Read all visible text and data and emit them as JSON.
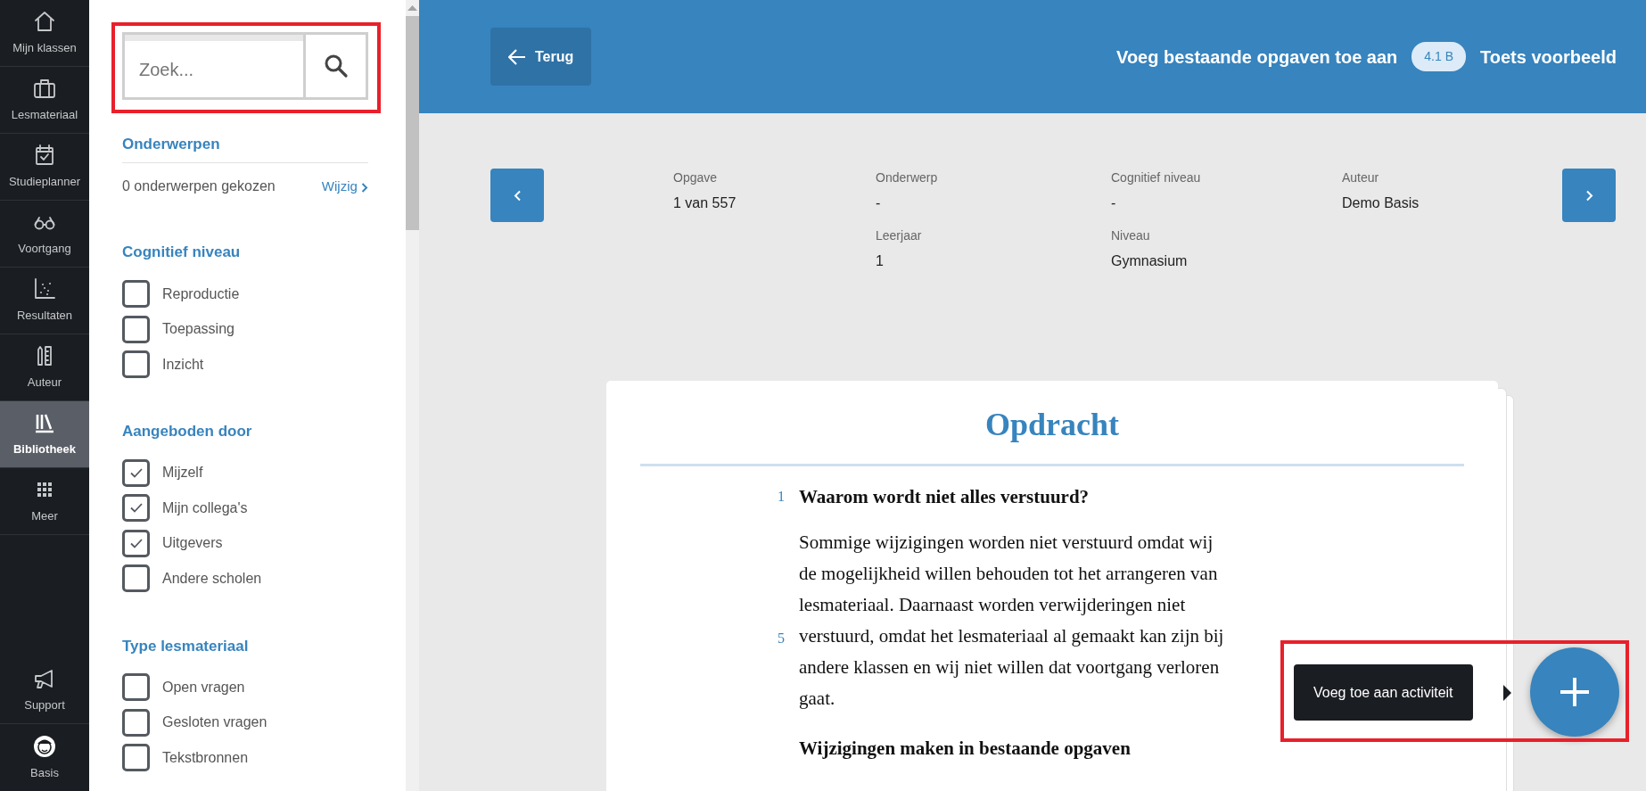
{
  "nav": {
    "items": [
      {
        "label": "Mijn klassen",
        "selected": false
      },
      {
        "label": "Lesmateriaal",
        "selected": false
      },
      {
        "label": "Studieplanner",
        "selected": false
      },
      {
        "label": "Voortgang",
        "selected": false
      },
      {
        "label": "Resultaten",
        "selected": false
      },
      {
        "label": "Auteur",
        "selected": false
      },
      {
        "label": "Bibliotheek",
        "selected": true
      },
      {
        "label": "Meer",
        "selected": false
      }
    ],
    "bottom_items": [
      {
        "label": "Support"
      },
      {
        "label": "Basis"
      }
    ]
  },
  "filters": {
    "search": {
      "placeholder": "Zoek..."
    },
    "topics": {
      "title": "Onderwerpen",
      "summary": "0 onderwerpen gekozen",
      "link": "Wijzig"
    },
    "groups": [
      {
        "title": "Cognitief niveau",
        "options": [
          {
            "label": "Reproductie",
            "checked": false
          },
          {
            "label": "Toepassing",
            "checked": false
          },
          {
            "label": "Inzicht",
            "checked": false
          }
        ]
      },
      {
        "title": "Aangeboden door",
        "options": [
          {
            "label": "Mijzelf",
            "checked": true
          },
          {
            "label": "Mijn collega's",
            "checked": true
          },
          {
            "label": "Uitgevers",
            "checked": true
          },
          {
            "label": "Andere scholen",
            "checked": false
          }
        ]
      },
      {
        "title": "Type lesmateriaal",
        "options": [
          {
            "label": "Open vragen",
            "checked": false
          },
          {
            "label": "Gesloten vragen",
            "checked": false
          },
          {
            "label": "Tekstbronnen",
            "checked": false
          }
        ]
      }
    ]
  },
  "header": {
    "back": "Terug",
    "title": "Voeg bestaande opgaven toe aan",
    "badge": "4.1 B",
    "subject": "Toets voorbeeld"
  },
  "meta": {
    "columns": [
      [
        {
          "label": "Opgave",
          "value": "1 van 557"
        }
      ],
      [
        {
          "label": "Onderwerp",
          "value": "-"
        },
        {
          "label": "Leerjaar",
          "value": "1"
        }
      ],
      [
        {
          "label": "Cognitief niveau",
          "value": "-"
        },
        {
          "label": "Niveau",
          "value": "Gymnasium"
        }
      ],
      [
        {
          "label": "Auteur",
          "value": "Demo Basis"
        }
      ]
    ]
  },
  "assignment": {
    "title": "Opdracht",
    "blocks": [
      {
        "kind": "heading",
        "line_number": "1",
        "text": "Waarom wordt niet alles verstuurd?"
      },
      {
        "kind": "paragraph",
        "line_number": "5",
        "text": "Sommige wijzigingen worden niet verstuurd omdat wij de mogelijkheid willen behouden tot het arrangeren van lesmateriaal. Daarnaast worden verwijderingen niet verstuurd, omdat het lesmateriaal al gemaakt kan zijn bij andere klassen en wij niet willen dat voortgang verloren gaat."
      },
      {
        "kind": "heading",
        "text": "Wijzigingen maken in bestaande opgaven"
      }
    ]
  },
  "action": {
    "tooltip": "Voeg toe aan activiteit"
  }
}
